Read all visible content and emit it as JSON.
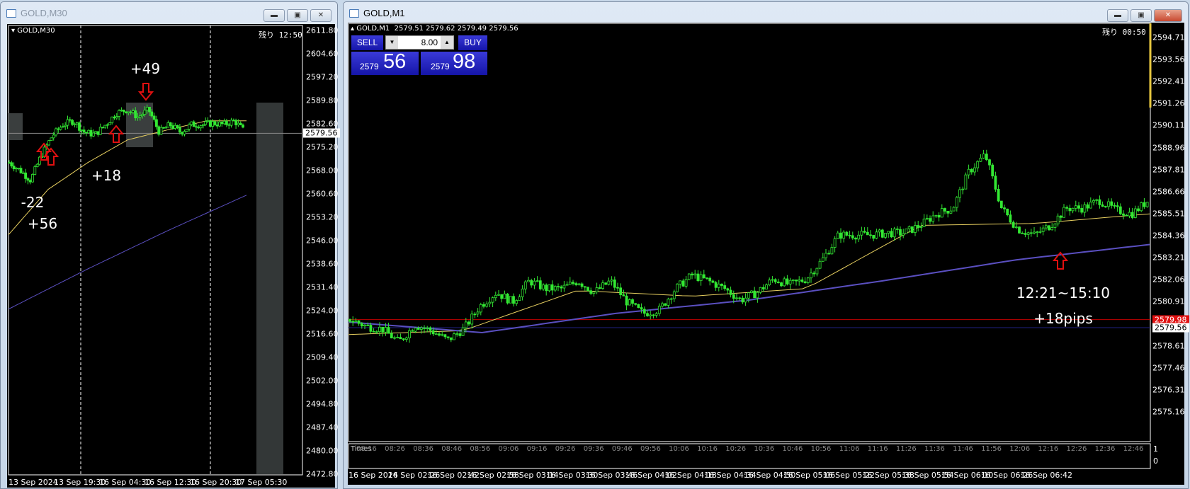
{
  "left_window": {
    "title": "GOLD,M30",
    "chart_label": "GOLD,M30",
    "remaining": "残り 12:50",
    "price_ticks": [
      "2611.80",
      "2604.60",
      "2597.20",
      "2589.80",
      "2582.60",
      "2575.20",
      "2568.00",
      "2560.60",
      "2553.20",
      "2546.00",
      "2538.60",
      "2531.40",
      "2524.00",
      "2516.60",
      "2509.40",
      "2502.00",
      "2494.80",
      "2487.40",
      "2480.00",
      "2472.80"
    ],
    "current_price": "2579.56",
    "time_labels": [
      "13 Sep 2024",
      "13 Sep 19:30",
      "16 Sep 04:30",
      "16 Sep 12:30",
      "16 Sep 20:30",
      "17 Sep 05:30"
    ],
    "annotations": [
      "+49",
      "+18",
      "-22",
      "+56"
    ],
    "price_path": [
      2570.4,
      2568.0,
      2564.9,
      2572.8,
      2578.7,
      2582.3,
      2583.5,
      2579.9,
      2579.2,
      2582.3,
      2585.9,
      2587.0,
      2584.7,
      2587.0,
      2579.9,
      2582.3,
      2579.9,
      2582.3,
      2582.3,
      2582.8,
      2582.3,
      2583.5,
      2579.9
    ],
    "ma_fast": [
      2547.8,
      2562.0,
      2570.4,
      2577.5,
      2580.6,
      2583.5,
      2583.5
    ],
    "ma_slow": [
      2524.5,
      2537.1,
      2549.0,
      2560.2
    ]
  },
  "right_window": {
    "title": "GOLD,M1",
    "chart_label": "GOLD,M1",
    "ohlc": "2579.51 2579.62 2579.49 2579.56",
    "remaining": "残り 00:50",
    "trade_panel": {
      "sell_label": "SELL",
      "buy_label": "BUY",
      "lot": "8.00",
      "sell_big": "2579",
      "sell_small": "56",
      "buy_big": "2579",
      "buy_small": "98"
    },
    "price_ticks": [
      "2594.71",
      "2593.56",
      "2592.41",
      "2591.26",
      "2590.11",
      "2588.96",
      "2587.81",
      "2586.66",
      "2585.51",
      "2584.36",
      "2583.21",
      "2582.06",
      "2580.91",
      "2579.98",
      "2579.56",
      "2578.61",
      "2577.46",
      "2576.31",
      "2575.16"
    ],
    "ask_price": "2579.98",
    "bid_price": "2579.56",
    "sub_indicator": {
      "name": "Times",
      "scale_top": "1",
      "scale_bottom": "0",
      "labels": [
        "08:16",
        "08:26",
        "08:36",
        "08:46",
        "08:56",
        "09:06",
        "09:16",
        "09:26",
        "09:36",
        "09:46",
        "09:56",
        "10:06",
        "10:16",
        "10:26",
        "10:36",
        "10:46",
        "10:56",
        "11:06",
        "11:16",
        "11:26",
        "11:36",
        "11:46",
        "11:56",
        "12:06",
        "12:16",
        "12:26",
        "12:36",
        "12:46"
      ]
    },
    "time_labels": [
      "16 Sep 2024",
      "16 Sep 02:26",
      "16 Sep 02:42",
      "16 Sep 02:58",
      "16 Sep 03:14",
      "16 Sep 03:30",
      "16 Sep 03:46",
      "16 Sep 04:02",
      "16 Sep 04:18",
      "16 Sep 04:34",
      "16 Sep 04:50",
      "16 Sep 05:06",
      "16 Sep 05:22",
      "16 Sep 05:38",
      "16 Sep 05:54",
      "16 Sep 06:10",
      "16 Sep 06:26",
      "16 Sep 06:42"
    ],
    "annotations": [
      "12:21~15:10",
      "+18pips"
    ],
    "price_path": [
      2580.0,
      2579.63,
      2579.48,
      2578.8,
      2579.7,
      2579.4,
      2578.9,
      2579.5,
      2580.7,
      2581.4,
      2580.9,
      2582.0,
      2581.6,
      2581.6,
      2582.0,
      2581.4,
      2582.0,
      2580.9,
      2580.3,
      2580.5,
      2581.6,
      2582.3,
      2582.0,
      2581.6,
      2581.0,
      2581.4,
      2582.1,
      2581.8,
      2582.1,
      2583.1,
      2584.4,
      2584.4,
      2584.4,
      2584.5,
      2584.5,
      2584.9,
      2585.5,
      2585.8,
      2587.7,
      2588.6,
      2585.8,
      2584.7,
      2584.4,
      2584.9,
      2585.8,
      2585.8,
      2586.2,
      2585.7,
      2585.5,
      2586.2
    ],
    "ma_fast": [
      2579.2,
      2579.4,
      2581.5,
      2581.2,
      2581.6,
      2584.9,
      2585.0,
      2585.5
    ],
    "ma_slow": [
      2579.85,
      2579.3,
      2580.3,
      2581.0,
      2582.0,
      2583.1,
      2583.9
    ]
  },
  "colors": {
    "candle": "#33e833",
    "ma_fast": "#e8d060",
    "ma_slow": "#5a4fc0",
    "ask_line": "#c00000",
    "bid_line": "#202080",
    "arrow": "#e01010"
  }
}
